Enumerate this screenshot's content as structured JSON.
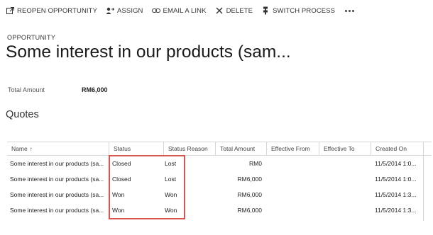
{
  "toolbar": {
    "items": [
      {
        "label": "REOPEN OPPORTUNITY",
        "icon": "reopen-icon"
      },
      {
        "label": "ASSIGN",
        "icon": "assign-icon"
      },
      {
        "label": "EMAIL A LINK",
        "icon": "link-icon"
      },
      {
        "label": "DELETE",
        "icon": "delete-icon"
      },
      {
        "label": "SWITCH PROCESS",
        "icon": "switch-process-icon"
      }
    ],
    "more_icon": "more-icon"
  },
  "header": {
    "entity": "OPPORTUNITY",
    "title": "Some interest in our products (sam..."
  },
  "fields": {
    "total_amount_label": "Total Amount",
    "total_amount_value": "RM6,000"
  },
  "quotes": {
    "section_title": "Quotes",
    "columns": [
      "Name",
      "Status",
      "Status Reason",
      "Total Amount",
      "Effective From",
      "Effective To",
      "Created On"
    ],
    "sort_indicator": "↑",
    "rows": [
      [
        "Some interest in our products (sa...",
        "Closed",
        "Lost",
        "RM0",
        "",
        "",
        "11/5/2014 1:0..."
      ],
      [
        "Some interest in our products (sa...",
        "Closed",
        "Lost",
        "RM6,000",
        "",
        "",
        "11/5/2014 1:0..."
      ],
      [
        "Some interest in our products (sa...",
        "Won",
        "Won",
        "RM6,000",
        "",
        "",
        "11/5/2014 1:3..."
      ],
      [
        "Some interest in our products (sa...",
        "Won",
        "Won",
        "RM6,000",
        "",
        "",
        "11/5/2014 1:3..."
      ]
    ]
  },
  "colors": {
    "highlight_border": "#d9534f",
    "grid_border": "#d6d6d6"
  }
}
